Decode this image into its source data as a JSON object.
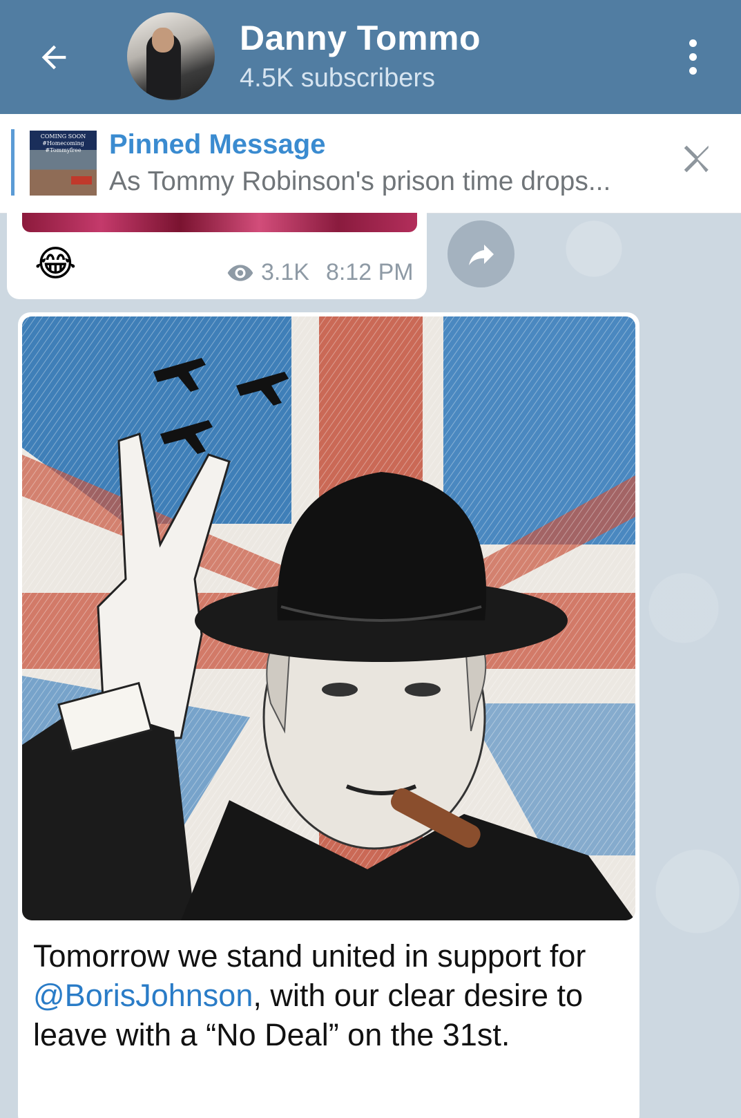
{
  "header": {
    "title": "Danny Tommo",
    "subscribers": "4.5K subscribers",
    "color": "#517da2"
  },
  "pinned": {
    "title": "Pinned Message",
    "preview": "As Tommy Robinson's prison time drops...",
    "thumb_line1": "COMING SOON",
    "thumb_line2": "#Homecoming",
    "thumb_line3": "#Tommyfree"
  },
  "prev_message": {
    "emoji": "😂",
    "views": "3.1K",
    "time": "8:12 PM"
  },
  "message": {
    "caption_before": "Tomorrow we stand united in support for ",
    "mention": "@BorisJohnson",
    "caption_after": ", with our clear desire to leave with a “No Deal” on the 31st."
  },
  "icons": {
    "back": "arrow-left-icon",
    "menu": "more-vertical-icon",
    "close": "close-icon",
    "views": "eye-icon",
    "share": "share-icon"
  }
}
